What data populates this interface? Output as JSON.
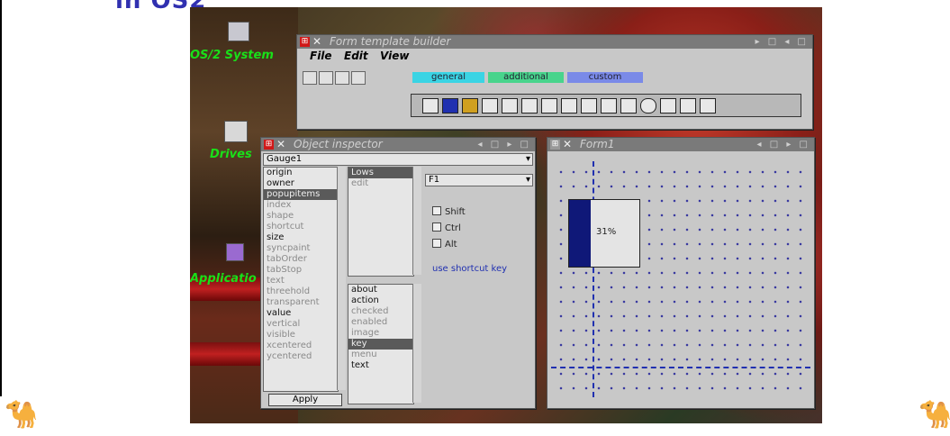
{
  "slide": {
    "title": "in OS2"
  },
  "desktop": {
    "icons": [
      {
        "label": "OS/2 System",
        "icon": "computer-icon"
      },
      {
        "label": "Drives",
        "icon": "drive-icon"
      },
      {
        "label": "Applicatio",
        "icon": "application-icon"
      }
    ]
  },
  "builder": {
    "title": "Form template builder",
    "controls": "▸ □ ◂ □",
    "menu": [
      "File",
      "Edit",
      "View"
    ],
    "tabs": [
      "general",
      "additional",
      "custom"
    ],
    "tab_colors": [
      "#3ad4e4",
      "#48d48c",
      "#7a8ae8"
    ]
  },
  "inspector": {
    "title": "Object inspector",
    "controls": "◂ □ ▸ □",
    "selected_object": "Gauge1",
    "properties": [
      {
        "label": "origin",
        "bold": true
      },
      {
        "label": "owner",
        "bold": true
      },
      {
        "label": "popupitems",
        "selected": true
      },
      {
        "label": "index"
      },
      {
        "label": "shape"
      },
      {
        "label": "shortcut"
      },
      {
        "label": "size",
        "bold": true
      },
      {
        "label": "syncpaint"
      },
      {
        "label": "tabOrder"
      },
      {
        "label": "tabStop"
      },
      {
        "label": "text"
      },
      {
        "label": "threehold"
      },
      {
        "label": "transparent"
      },
      {
        "label": "value",
        "bold": true
      },
      {
        "label": "vertical"
      },
      {
        "label": "visible"
      },
      {
        "label": "xcentered"
      },
      {
        "label": "ycentered"
      }
    ],
    "tree": [
      {
        "label": "Lows",
        "selected": true
      },
      {
        "label": "edit"
      }
    ],
    "events": [
      {
        "label": "about",
        "bold": true
      },
      {
        "label": "action",
        "bold": true
      },
      {
        "label": "checked"
      },
      {
        "label": "enabled"
      },
      {
        "label": "image"
      },
      {
        "label": "key",
        "selected": true
      },
      {
        "label": "menu"
      },
      {
        "label": "text",
        "bold": true
      }
    ],
    "modifier_value": "F1",
    "modifiers": [
      "Shift",
      "Ctrl",
      "Alt"
    ],
    "shortcut_caption": "use shortcut key",
    "apply_label": "Apply"
  },
  "form": {
    "title": "Form1",
    "controls": "◂ □ ▸ □",
    "gauge": {
      "value_text": "31%",
      "value": 0.31
    }
  }
}
